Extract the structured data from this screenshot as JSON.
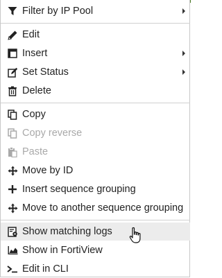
{
  "menu": {
    "items": [
      {
        "label": "Filter by IP Pool",
        "icon": "filter-icon",
        "submenu": true,
        "enabled": true
      },
      {
        "label": "Edit",
        "icon": "pencil-icon",
        "submenu": false,
        "enabled": true
      },
      {
        "label": "Insert",
        "icon": "insert-icon",
        "submenu": true,
        "enabled": true
      },
      {
        "label": "Set Status",
        "icon": "edit-status-icon",
        "submenu": true,
        "enabled": true
      },
      {
        "label": "Delete",
        "icon": "trash-icon",
        "submenu": false,
        "enabled": true
      },
      {
        "label": "Copy",
        "icon": "copy-icon",
        "submenu": false,
        "enabled": true
      },
      {
        "label": "Copy reverse",
        "icon": "copy-icon",
        "submenu": false,
        "enabled": false
      },
      {
        "label": "Paste",
        "icon": "paste-icon",
        "submenu": false,
        "enabled": false
      },
      {
        "label": "Move by ID",
        "icon": "move-arrows-icon",
        "submenu": false,
        "enabled": true
      },
      {
        "label": "Insert sequence grouping",
        "icon": "plus-icon",
        "submenu": false,
        "enabled": true
      },
      {
        "label": "Move to another sequence grouping",
        "icon": "move-arrows-icon",
        "submenu": false,
        "enabled": true
      },
      {
        "label": "Show matching logs",
        "icon": "logs-gear-icon",
        "submenu": false,
        "enabled": true,
        "hovered": true
      },
      {
        "label": "Show in FortiView",
        "icon": "area-chart-icon",
        "submenu": false,
        "enabled": true
      },
      {
        "label": "Edit in CLI",
        "icon": "terminal-icon",
        "submenu": false,
        "enabled": true
      }
    ]
  }
}
